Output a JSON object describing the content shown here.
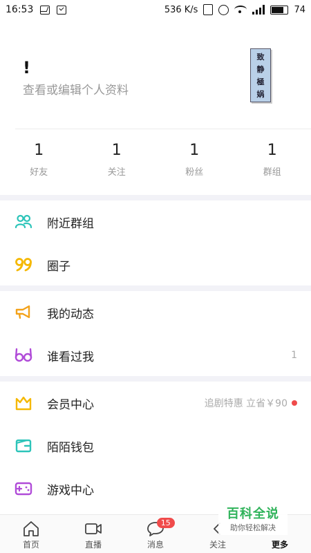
{
  "status_bar": {
    "time": "16:53",
    "net_speed": "536 K/s",
    "battery": "74"
  },
  "profile": {
    "name": "!",
    "subtitle": "查看或编辑个人资料",
    "avatar_text": [
      "致",
      "静",
      "極",
      "娲"
    ]
  },
  "stats": [
    {
      "value": "1",
      "label": "好友"
    },
    {
      "value": "1",
      "label": "关注"
    },
    {
      "value": "1",
      "label": "粉丝"
    },
    {
      "value": "1",
      "label": "群组"
    }
  ],
  "menu": {
    "nearby_groups": "附近群组",
    "circle": "圈子",
    "my_feed": "我的动态",
    "who_viewed": "谁看过我",
    "who_viewed_count": "1",
    "vip_center": "会员中心",
    "vip_promo": "追剧特惠 立省￥90",
    "wallet": "陌陌钱包",
    "game_center": "游戏中心"
  },
  "tabs": {
    "home": "首页",
    "live": "直播",
    "messages": "消息",
    "messages_badge": "15",
    "follow": "关注",
    "more": "更多"
  },
  "watermark": {
    "title": "百科全说",
    "subtitle": "助你轻松解决"
  },
  "colors": {
    "teal": "#2cc4b9",
    "yellow": "#f5b800",
    "orange": "#f3a21a",
    "purple": "#b04bd8",
    "red": "#ef4b4b"
  }
}
